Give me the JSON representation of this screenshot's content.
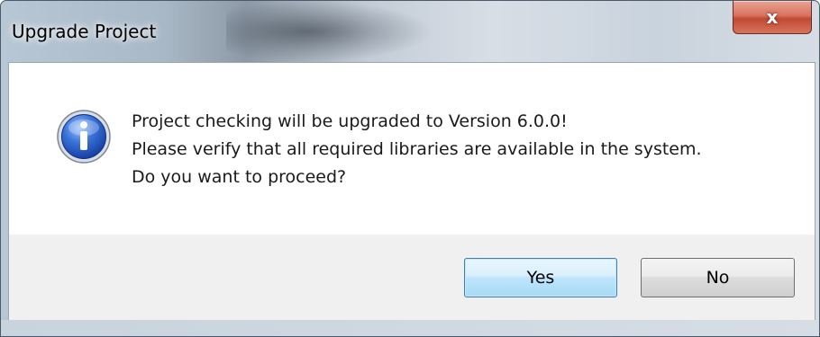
{
  "window": {
    "title": "Upgrade Project",
    "close_label": "x"
  },
  "dialog": {
    "icon": "info-icon",
    "message_lines": [
      "Project checking will be upgraded to Version 6.0.0!",
      "Please verify that all required libraries are available in the system.",
      "Do you want to proceed?"
    ]
  },
  "buttons": {
    "yes_label": "Yes",
    "no_label": "No"
  },
  "colors": {
    "yes_button_accent": "#3c7fb1",
    "close_button": "#c14a33",
    "info_icon": "#1d4fbf"
  }
}
